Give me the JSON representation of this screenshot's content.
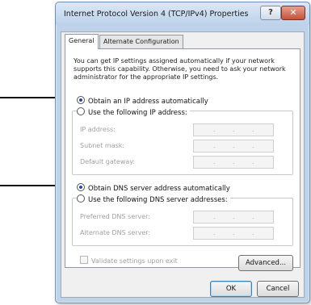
{
  "window": {
    "title": "Internet Protocol Version 4 (TCP/IPv4) Properties",
    "help_label": "?",
    "close_label": "✕"
  },
  "tabs": [
    {
      "label": "General",
      "active": true
    },
    {
      "label": "Alternate Configuration",
      "active": false
    }
  ],
  "description": "You can get IP settings assigned automatically if your network supports this capability. Otherwise, you need to ask your network administrator for the appropriate IP settings.",
  "ip": {
    "auto_label": "Obtain an IP address automatically",
    "auto_selected": true,
    "manual_label": "Use the following IP address:",
    "fields": [
      {
        "label": "IP address:"
      },
      {
        "label": "Subnet mask:"
      },
      {
        "label": "Default gateway:"
      }
    ]
  },
  "dns": {
    "auto_label": "Obtain DNS server address automatically",
    "auto_selected": true,
    "manual_label": "Use the following DNS server addresses:",
    "fields": [
      {
        "label": "Preferred DNS server:"
      },
      {
        "label": "Alternate DNS server:"
      }
    ]
  },
  "validate_label": "Validate settings upon exit",
  "buttons": {
    "advanced": "Advanced...",
    "ok": "OK",
    "cancel": "Cancel"
  },
  "ip_dot_glyph": "."
}
